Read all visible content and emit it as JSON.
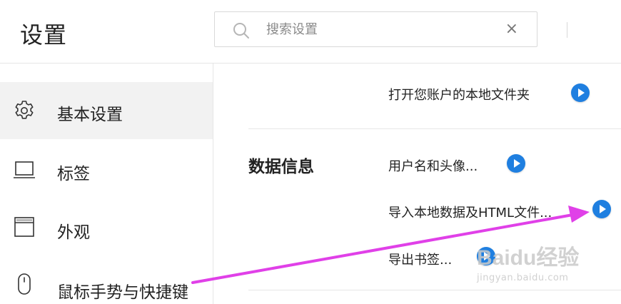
{
  "header": {
    "title": "设置",
    "search": {
      "placeholder": "搜索设置",
      "value": "",
      "clear_glyph": "×"
    }
  },
  "sidebar": {
    "items": [
      {
        "label": "基本设置",
        "icon": "gear-icon",
        "active": true
      },
      {
        "label": "标签",
        "icon": "laptop-icon",
        "active": false
      },
      {
        "label": "外观",
        "icon": "window-icon",
        "active": false
      },
      {
        "label": "鼠标手势与快捷键",
        "icon": "mouse-icon",
        "active": false
      }
    ]
  },
  "main": {
    "open_folder_label": "打开您账户的本地文件夹",
    "data_section": {
      "title": "数据信息",
      "items": [
        {
          "label": "用户名和头像..."
        },
        {
          "label": "导入本地数据及HTML文件..."
        },
        {
          "label": "导出书签..."
        }
      ]
    }
  },
  "annotation": {
    "type": "arrow",
    "color": "#e040e8"
  },
  "watermark": {
    "logo": "Baidu经验",
    "url": "jingyan.baidu.com"
  },
  "colors": {
    "accent": "#1f7fe0",
    "active_bg": "#f2f2f2",
    "arrow": "#e040e8"
  }
}
